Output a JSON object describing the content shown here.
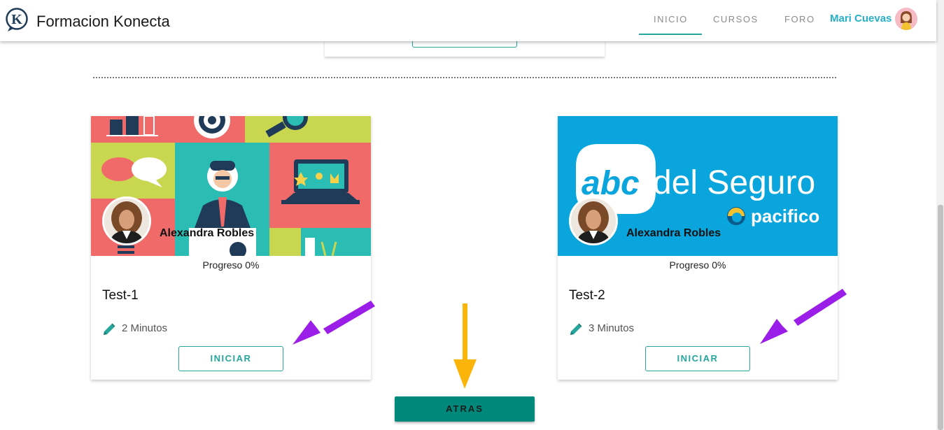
{
  "header": {
    "brand": "Formacion Konecta",
    "nav": [
      {
        "label": "INICIO",
        "active": true
      },
      {
        "label": "CURSOS",
        "active": false
      },
      {
        "label": "FORO",
        "active": false
      }
    ],
    "user_name": "Mari Cuevas"
  },
  "cards": [
    {
      "image_caption": "",
      "instructor": "Alexandra Robles",
      "progress": "Progreso 0%",
      "progress_value": 0,
      "title": "Test-1",
      "duration": "2 Minutos",
      "button": "INICIAR"
    },
    {
      "image_text_main_1": "abc",
      "image_text_main_2": "del Seguro",
      "image_text_sub": "pacifico",
      "instructor": "Alexandra Robles",
      "progress": "Progreso 0%",
      "progress_value": 0,
      "title": "Test-2",
      "duration": "3 Minutos",
      "button": "INICIAR"
    }
  ],
  "back_button": "ATRAS",
  "colors": {
    "accent": "#26a69a",
    "back_button": "#00897b",
    "user_name": "#26b0c7",
    "annotation_purple": "#9b1de8",
    "annotation_orange": "#fbb40a",
    "banner_blue": "#0aa5dc"
  },
  "icons": [
    "konecta-logo-icon",
    "user-avatar-icon",
    "pencil-icon"
  ]
}
